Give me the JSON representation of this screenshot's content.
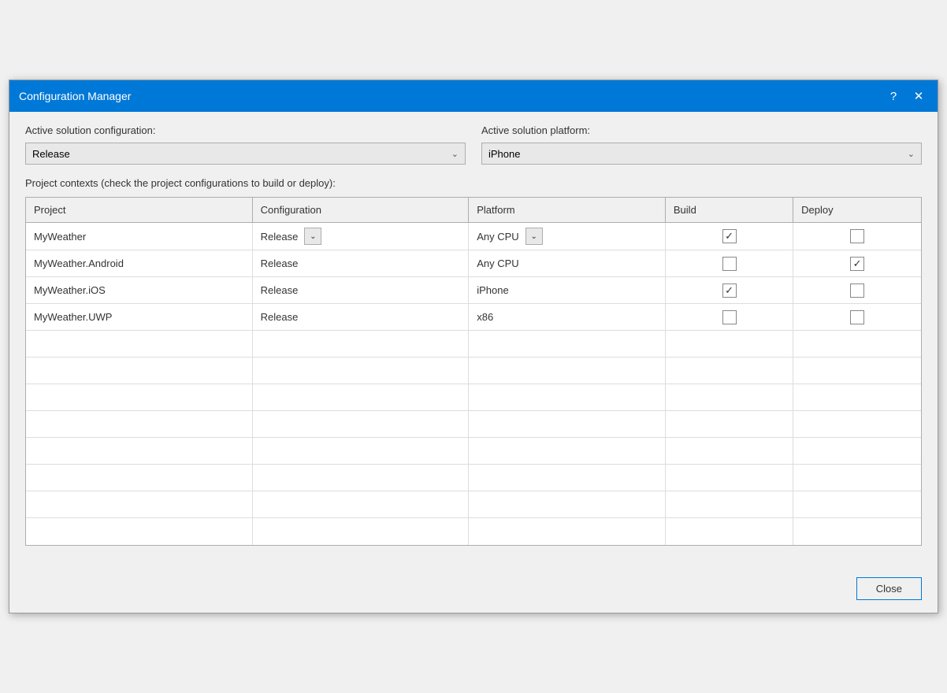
{
  "titleBar": {
    "title": "Configuration Manager",
    "helpBtn": "?",
    "closeBtn": "✕"
  },
  "form": {
    "configLabel": "Active solution configuration:",
    "configValue": "Release",
    "platformLabel": "Active solution platform:",
    "platformValue": "iPhone"
  },
  "sectionLabel": "Project contexts (check the project configurations to build or deploy):",
  "table": {
    "headers": [
      "Project",
      "Configuration",
      "Platform",
      "Build",
      "Deploy"
    ],
    "rows": [
      {
        "project": "MyWeather",
        "config": "Release",
        "hasConfigDropdown": true,
        "platform": "Any CPU",
        "hasPlatformDropdown": true,
        "build": true,
        "deploy": false
      },
      {
        "project": "MyWeather.Android",
        "config": "Release",
        "hasConfigDropdown": false,
        "platform": "Any CPU",
        "hasPlatformDropdown": false,
        "build": false,
        "deploy": true
      },
      {
        "project": "MyWeather.iOS",
        "config": "Release",
        "hasConfigDropdown": false,
        "platform": "iPhone",
        "hasPlatformDropdown": false,
        "build": true,
        "deploy": false
      },
      {
        "project": "MyWeather.UWP",
        "config": "Release",
        "hasConfigDropdown": false,
        "platform": "x86",
        "hasPlatformDropdown": false,
        "build": false,
        "deploy": false
      }
    ],
    "emptyRowCount": 8
  },
  "footer": {
    "closeLabel": "Close"
  }
}
